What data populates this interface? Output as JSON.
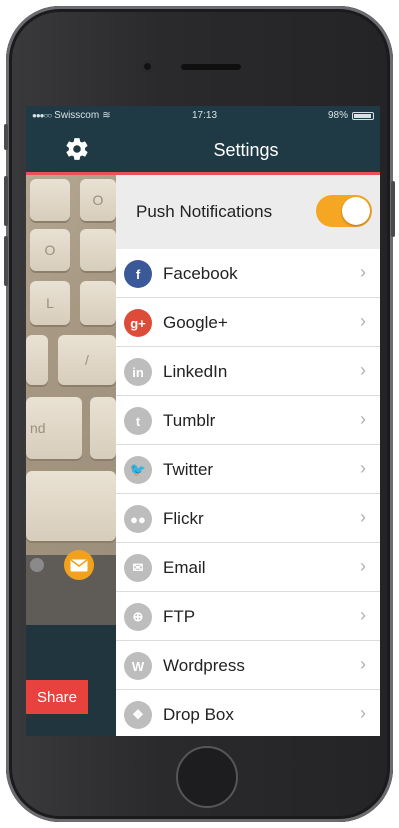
{
  "status_bar": {
    "signal": "●●●○○",
    "carrier": "Swisscom",
    "wifi": "≋",
    "time": "17:13",
    "battery_percent": "98%"
  },
  "nav": {
    "title": "Settings"
  },
  "push": {
    "label": "Push Notifications",
    "enabled": true
  },
  "share_label": "Share",
  "photo_keys": [
    "O",
    "O",
    "L",
    "nd",
    "/"
  ],
  "services": [
    {
      "label": "Facebook",
      "icon": "facebook-icon",
      "glyph": "f",
      "color": "#3b5998"
    },
    {
      "label": "Google+",
      "icon": "google-plus-icon",
      "glyph": "g+",
      "color": "#dd4b39"
    },
    {
      "label": "LinkedIn",
      "icon": "linkedin-icon",
      "glyph": "in",
      "color": "#bdbdbd"
    },
    {
      "label": "Tumblr",
      "icon": "tumblr-icon",
      "glyph": "t",
      "color": "#bdbdbd"
    },
    {
      "label": "Twitter",
      "icon": "twitter-icon",
      "glyph": "🐦",
      "color": "#bdbdbd"
    },
    {
      "label": "Flickr",
      "icon": "flickr-icon",
      "glyph": "●●",
      "color": "#bdbdbd"
    },
    {
      "label": "Email",
      "icon": "email-icon",
      "glyph": "✉",
      "color": "#bdbdbd"
    },
    {
      "label": "FTP",
      "icon": "ftp-globe-icon",
      "glyph": "⊕",
      "color": "#bdbdbd"
    },
    {
      "label": "Wordpress",
      "icon": "wordpress-icon",
      "glyph": "W",
      "color": "#bdbdbd"
    },
    {
      "label": "Drop Box",
      "icon": "dropbox-icon",
      "glyph": "❖",
      "color": "#bdbdbd"
    }
  ],
  "colors": {
    "navbar": "#1f3a45",
    "accent_line": "#e8505b",
    "toggle_on": "#f5a623",
    "share_button": "#e8423f"
  }
}
